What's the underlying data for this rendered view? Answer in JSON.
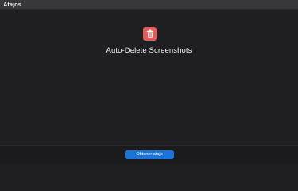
{
  "window": {
    "title": "Atajos"
  },
  "shortcut": {
    "icon": "trash-icon",
    "name": "Auto-Delete Screenshots",
    "icon_color": "#e85a5a"
  },
  "footer": {
    "get_button_label": "Obtener atajo",
    "accent": "#1a73d9"
  }
}
